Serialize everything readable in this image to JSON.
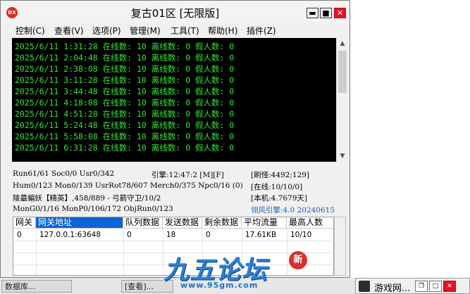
{
  "window": {
    "title": "复古01区 [无限版]",
    "icon_text": "DX"
  },
  "title_buttons": {
    "minimize": "▬",
    "maximize": "■",
    "close": "✕"
  },
  "menu": [
    "控制(C)",
    "查看(V)",
    "选项(P)",
    "管理(M)",
    "工具(T)",
    "帮助(H)",
    "插件(Z)"
  ],
  "log_lines": [
    "2025/6/11 1:31:28 在线数: 10 离线数: 0 假人数: 0",
    "2025/6/11 2:04:48 在线数: 10 离线数: 0 假人数: 0",
    "2025/6/11 2:38:08 在线数: 10 离线数: 0 假人数: 0",
    "2025/6/11 3:11:28 在线数: 10 离线数: 0 假人数: 0",
    "2025/6/11 3:44:48 在线数: 10 离线数: 0 假人数: 0",
    "2025/6/11 4:18:08 在线数: 10 离线数: 0 假人数: 0",
    "2025/6/11 4:51:28 在线数: 10 离线数: 0 假人数: 0",
    "2025/6/11 5:24:48 在线数: 10 离线数: 0 假人数: 0",
    "2025/6/11 5:58:08 在线数: 10 离线数: 0 假人数: 0",
    "2025/6/11 6:31:28 在线数: 10 离线数: 0 假人数: 0"
  ],
  "status": {
    "run": "Run61/61 Soc0/0 Usr0/342",
    "engine": "引擎:12:47:2 [M][F]",
    "refresh": "[刷怪:4492;129]",
    "hum": "Hum0/123 Mon0/139 UsrRot78/607 Merch0/375 Npc0/16 (0)",
    "online": "[在线:10/10/0]",
    "boss": "陵墓蝙妖【精英】,458/889 - 弓箭守卫/10/2",
    "local": "[本机:4.7679天]",
    "mongo": "MonG0/1/16 MonP0/106/172 ObjRun0/123",
    "engine_version": "翎风引擎:4.0 20240615"
  },
  "gateway_table": {
    "columns": [
      "网关",
      "网关地址",
      "队列数据",
      "发送数据",
      "剩余数据",
      "平均流量",
      "最高人数"
    ],
    "rows": [
      [
        "0",
        "127.0.0.1:63648",
        "0",
        "18",
        "0",
        "17.61KB",
        "10/10"
      ]
    ]
  },
  "taskbar": {
    "right_label": "游戏网...",
    "left_items": [
      "数据库...",
      "[查看]..."
    ]
  },
  "watermark": {
    "site": "九五论坛",
    "url": "www.95gm.com",
    "seal": "新"
  }
}
